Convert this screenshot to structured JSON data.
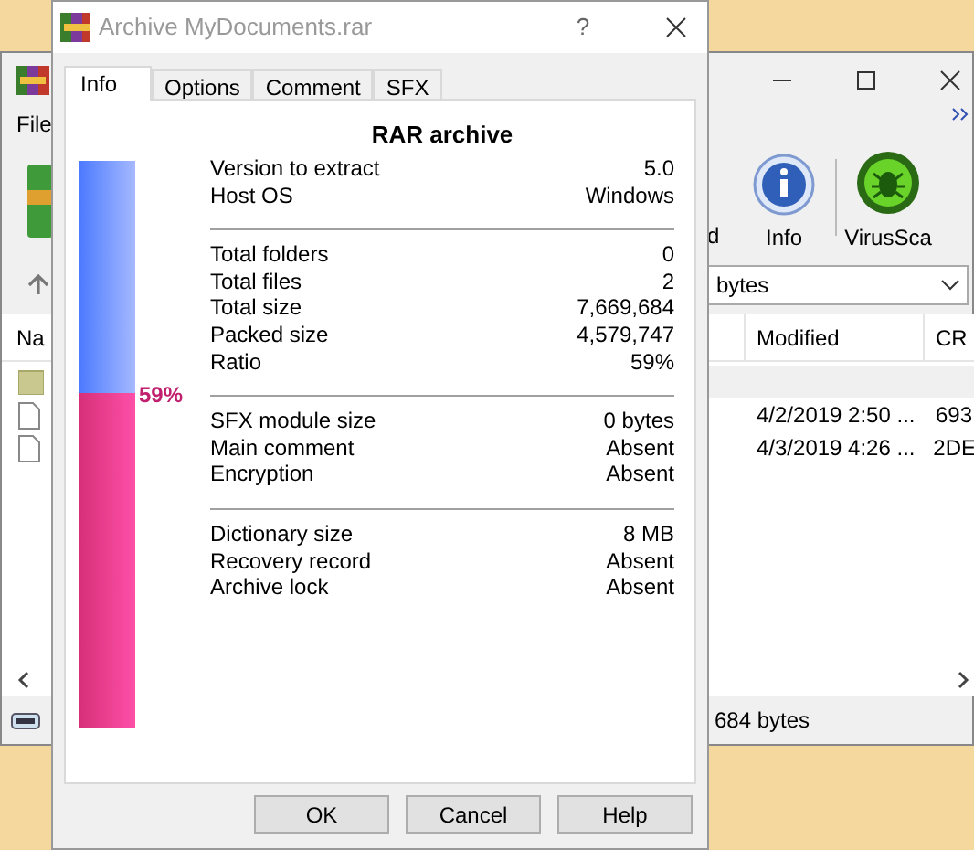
{
  "main_window": {
    "menu": [
      "File"
    ],
    "toolbar": [
      {
        "label": "d",
        "kind": "text"
      },
      {
        "label": "Info",
        "kind": "info"
      },
      {
        "label": "VirusSca",
        "kind": "virus"
      }
    ],
    "address": "bytes",
    "columns_left": [
      "Na"
    ],
    "columns_right": [
      "Modified",
      "CR"
    ],
    "rows": [
      {
        "kind": "folder",
        "modified": "",
        "crc": ""
      },
      {
        "kind": "file",
        "modified": "4/2/2019 2:50 ...",
        "crc": "693"
      },
      {
        "kind": "file",
        "modified": "4/3/2019 4:26 ...",
        "crc": "2DE"
      }
    ],
    "status": "684 bytes"
  },
  "dialog": {
    "title": "Archive MyDocuments.rar",
    "help": "?",
    "tabs": [
      {
        "label": "Info",
        "selected": true
      },
      {
        "label": "Options",
        "selected": false
      },
      {
        "label": "Comment",
        "selected": false
      },
      {
        "label": "SFX",
        "selected": false
      }
    ],
    "heading": "RAR archive",
    "ratio_bar": {
      "level": 0.59,
      "reading": "59%"
    },
    "sections": [
      {
        "rows": [
          {
            "label": "Version to extract",
            "value": "5.0"
          },
          {
            "label": "Host OS",
            "value": "Windows"
          }
        ]
      },
      {
        "rows": [
          {
            "label": "Total folders",
            "value": "0"
          },
          {
            "label": "Total files",
            "value": "2"
          },
          {
            "label": "Total size",
            "value": "7,669,684"
          },
          {
            "label": "Packed size",
            "value": "4,579,747"
          },
          {
            "label": "Ratio",
            "value": "59%"
          }
        ]
      },
      {
        "rows": [
          {
            "label": "SFX module size",
            "value": "0 bytes"
          },
          {
            "label": "Main comment",
            "value": "Absent"
          },
          {
            "label": "Encryption",
            "value": "Absent"
          }
        ]
      },
      {
        "rows": [
          {
            "label": "Dictionary size",
            "value": "8 MB"
          },
          {
            "label": "Recovery record",
            "value": "Absent"
          },
          {
            "label": "Archive lock",
            "value": "Absent"
          }
        ]
      }
    ],
    "buttons": [
      "OK",
      "Cancel",
      "Help"
    ]
  }
}
